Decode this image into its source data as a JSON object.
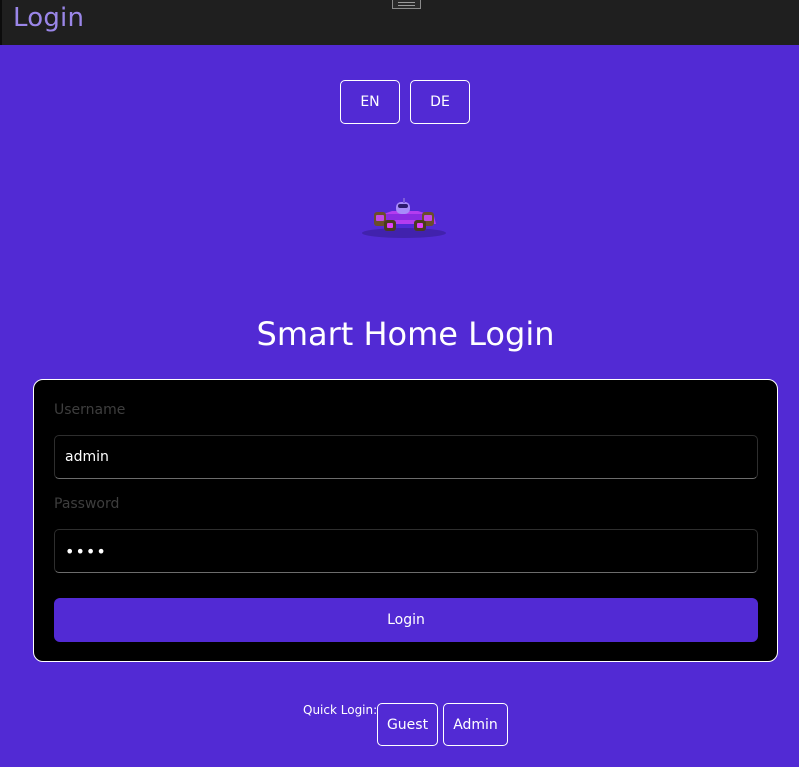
{
  "window": {
    "title": "Login"
  },
  "language": {
    "options": [
      "EN",
      "DE"
    ]
  },
  "logo": {
    "icon": "race-car-icon"
  },
  "heading": "Smart Home Login",
  "form": {
    "username_label": "Username",
    "username_value": "admin",
    "password_label": "Password",
    "password_value": "••••",
    "submit_label": "Login"
  },
  "quick_login": {
    "label": "Quick Login:",
    "guest_label": "Guest",
    "admin_label": "Admin"
  },
  "colors": {
    "background": "#522ad4",
    "topbar": "#1f1f1f",
    "title": "#9a86e8",
    "card": "#000000",
    "accent": "#522ad4"
  }
}
